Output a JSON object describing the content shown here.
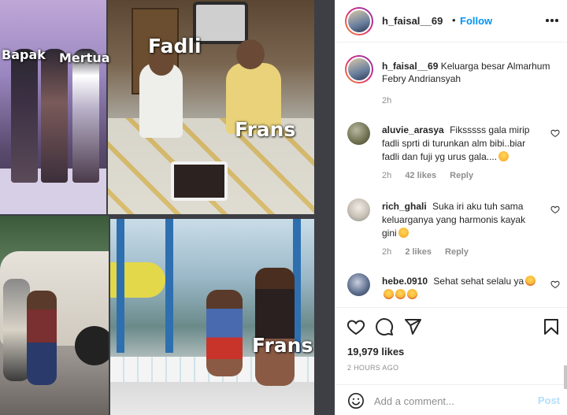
{
  "collage": {
    "captions": {
      "bapak": "Bapak",
      "mertua": "Mertua",
      "fadli": "Fadli",
      "frans_top": "Frans",
      "frans_bottom": "Frans"
    }
  },
  "header": {
    "username": "h_faisal__69",
    "separator": "•",
    "follow_label": "Follow",
    "more_icon": "more-horizontal-icon"
  },
  "caption": {
    "username": "h_faisal__69",
    "text": "Keluarga besar Almarhum Febry Andriansyah",
    "time": "2h"
  },
  "comments": [
    {
      "username": "aluvie_arasya",
      "text": "Fiksssss gala mirip fadli sprti di turunkan alm bibi..biar fadli dan fuji yg urus gala....",
      "emoji": "clap-emoji",
      "time": "2h",
      "likes": "42 likes",
      "reply_label": "Reply"
    },
    {
      "username": "rich_ghali",
      "text": "Suka iri aku tuh sama keluarganya yang harmonis kayak gini",
      "emoji": "crying-face-emoji",
      "time": "2h",
      "likes": "2 likes",
      "reply_label": "Reply"
    },
    {
      "username": "hebe.0910",
      "text": "Sehat sehat selalu ya",
      "emoji": "heart-eyes-emoji"
    }
  ],
  "actions": {
    "like_icon": "heart-icon",
    "comment_icon": "comment-icon",
    "share_icon": "send-icon",
    "save_icon": "bookmark-icon"
  },
  "likes_count": "19,979 likes",
  "post_time": "2 HOURS AGO",
  "add_comment": {
    "placeholder": "Add a comment...",
    "post_label": "Post",
    "emoji_icon": "emoji-smile-icon"
  },
  "colors": {
    "follow_blue": "#0095f6",
    "post_disabled": "#b2dffc",
    "muted_text": "#8e8e8e",
    "text": "#262626"
  }
}
